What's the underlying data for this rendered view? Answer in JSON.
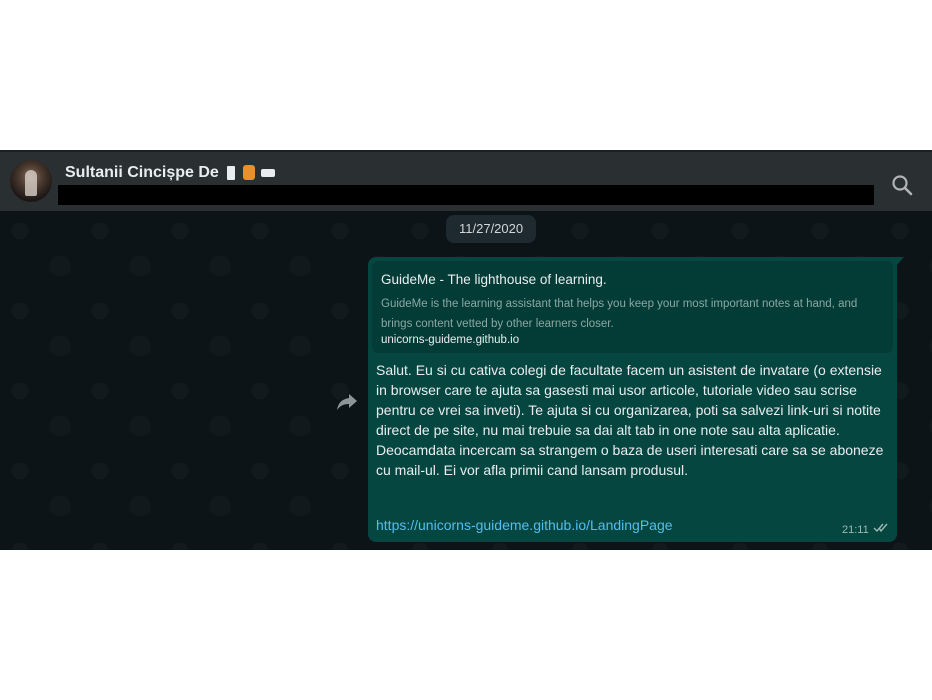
{
  "header": {
    "chat_name": "Sultanii Cincișpe De",
    "icons": [
      "flag-emoji",
      "backpack-emoji",
      "camera-emoji",
      "search-icon"
    ]
  },
  "chat": {
    "date_chip": "11/27/2020",
    "message": {
      "link_preview": {
        "title": "GuideMe - The lighthouse of learning.",
        "description": "GuideMe is the learning assistant that helps you keep your most important notes at hand, and brings content vetted by other learners closer.",
        "domain": "unicorns-guideme.github.io"
      },
      "text": "Salut. Eu si cu cativa colegi de facultate facem un asistent de invatare (o extensie in browser care te ajuta sa gasesti mai usor articole, tutoriale video sau scrise pentru ce vrei sa inveti). Te ajuta si cu organizarea, poti sa salvezi link-uri si notite direct de pe site, nu mai trebuie sa dai alt tab in one note sau alta aplicatie.\nDeocamdata incercam sa strangem o baza de useri interesati care sa se aboneze cu mail-ul. Ei vor afla primii cand lansam produsul.",
      "link": "https://unicorns-guideme.github.io/LandingPage",
      "time": "21:11",
      "status_icon": "double-check-icon"
    }
  },
  "colors": {
    "header_bg": "#2a2f32",
    "chat_bg": "#0d1418",
    "bubble_bg": "#054740",
    "link": "#53bdeb",
    "text": "#e9edef"
  }
}
